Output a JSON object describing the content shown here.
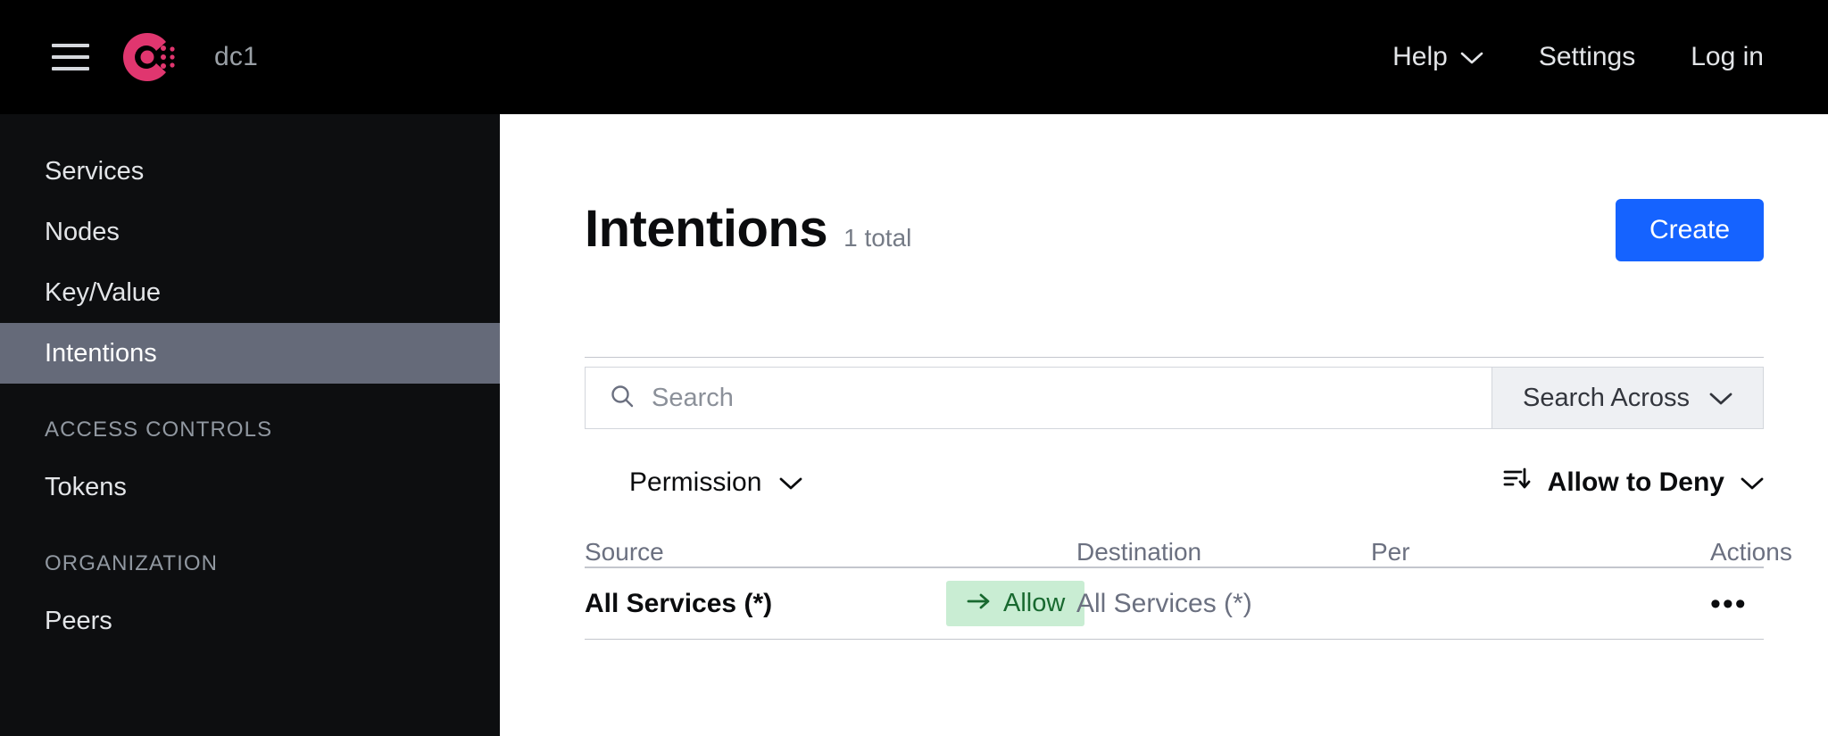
{
  "topnav": {
    "menu_icon": "hamburger-icon",
    "logo_icon": "consul-logo",
    "datacenter": "dc1",
    "links": [
      {
        "label": "Help",
        "has_chevron": true
      },
      {
        "label": "Settings",
        "has_chevron": false
      },
      {
        "label": "Log in",
        "has_chevron": false
      }
    ]
  },
  "sidebar": {
    "items": [
      {
        "label": "Services",
        "active": false
      },
      {
        "label": "Nodes",
        "active": false
      },
      {
        "label": "Key/Value",
        "active": false
      },
      {
        "label": "Intentions",
        "active": true
      }
    ],
    "sections": [
      {
        "heading": "ACCESS CONTROLS",
        "items": [
          {
            "label": "Tokens"
          }
        ]
      },
      {
        "heading": "ORGANIZATION",
        "items": [
          {
            "label": "Peers"
          }
        ]
      }
    ]
  },
  "page": {
    "title": "Intentions",
    "total": "1 total",
    "create_label": "Create"
  },
  "search": {
    "icon": "search-icon",
    "placeholder": "Search",
    "value": "",
    "across_label": "Search Across",
    "across_chevron": "chevron-down-icon"
  },
  "filters": {
    "permission_label": "Permission",
    "permission_chevron": "chevron-down-icon",
    "sort_icon": "sort-descending-icon",
    "sort_label": "Allow to Deny",
    "sort_chevron": "chevron-down-icon"
  },
  "table": {
    "headers": {
      "source": "Source",
      "destination": "Destination",
      "permissions": "Per",
      "actions": "Actions"
    },
    "rows": [
      {
        "source": "All Services (*)",
        "permission": "Allow",
        "permission_icon": "arrow-right-icon",
        "destination": "All Services (*)",
        "permissions": "",
        "actions_icon": "more-horizontal-icon"
      }
    ]
  },
  "colors": {
    "brand_pink": "#e0366f",
    "create_blue": "#1563ff",
    "allow_bg": "#c9edd3",
    "allow_fg": "#18692f",
    "nav_black": "#000000",
    "sidebar_black": "#0d0e10",
    "active_gray": "#656a79"
  }
}
